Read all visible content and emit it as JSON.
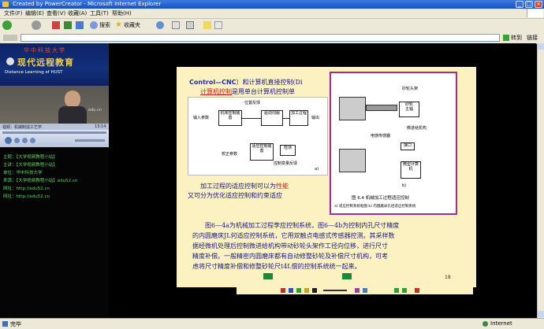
{
  "window": {
    "title": "Created by PowerCreator - Microsoft Internet Explorer",
    "controls": {
      "minimize": "_",
      "maximize": "□",
      "close": "×"
    }
  },
  "menu": [
    "文件(F)",
    "编辑(E)",
    "查看(V)",
    "收藏(A)",
    "工具(T)",
    "帮助(H)"
  ],
  "toolbar": {
    "search": "搜索",
    "favorites": "收藏夹",
    "go": "转到",
    "links": "链接"
  },
  "banner": {
    "title": "现代远程教育",
    "subtitle": "Distance Learning of HUST",
    "top": "华中科技大学"
  },
  "player": {
    "title": "视频：机械制造工艺学",
    "time": "13:14"
  },
  "info": [
    {
      "label": "主题：",
      "value": "【大学视频教程小站】"
    },
    {
      "label": "主讲：",
      "value": "【大学视频教程小站】"
    },
    {
      "label": "单位：",
      "value": "华中科技大学"
    },
    {
      "label": "来源：",
      "value": "【大学视频教程小站】edu52.cn"
    },
    {
      "label": "网址：",
      "value": "http://edu52.cn"
    },
    {
      "label": "网址：",
      "value": "http://edu52.cn"
    }
  ],
  "slide": {
    "line1_head": "Control—CNC",
    "line1": "）和计算机直接控制(Di",
    "line2_red": "计算机控制",
    "line2": "是用单台计算机控制单",
    "mid1": "加工过程的适应控制可以为",
    "mid1_red": "性能",
    "mid2": "又可分为优化适应控制和约束适应",
    "para": [
      "图6—4a为机械加工过程李应控制系统，图6—4b为控制内孔尺寸精度",
      "的内圆磨床JL何适应控制系统，它用双触点电感式传感器控测。其采样数",
      "据经微机处理后控制微进给机构带动砂轮头架作工径向位移，进行尺寸",
      "精度补偿。一般精密内圆磨床都有自动修整砂轮及补偿尺寸机构，可考",
      "虑将尺寸精度补偿和修整砂轮尺t4L偿的控制系统统一起来。"
    ],
    "page_num": "18",
    "diagram_a": {
      "position_fb": "位置反馈",
      "input": "输入参数",
      "machine_ctrl": "机床控制装置",
      "drive": "驱动伺服",
      "process": "加工过程",
      "output": "输出",
      "correction": "校正参数",
      "adaptive": "适应控制装置",
      "sense": "检测",
      "variable_fb": "控制变量反馈",
      "label": "a)"
    },
    "diagram_b": {
      "wheel_head": "砂轮头架",
      "wheel": "砂轮",
      "spindle": "主轴",
      "feed": "微进给机构",
      "sensor": "电感传感器",
      "interface": "接口",
      "computer": "微型计算机",
      "label": "b)",
      "caption": "图 6.4   机械加工过程适应控制",
      "sub": "a)  适应控制系统框图    b)  内圆磨床孔径适应控制系统"
    }
  },
  "status": {
    "left": "完毕",
    "zone": "Internet"
  }
}
